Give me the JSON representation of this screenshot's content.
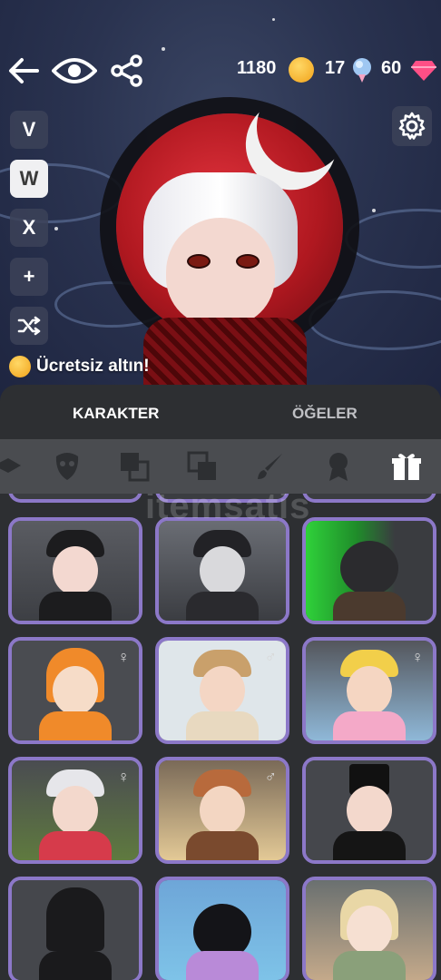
{
  "currency": {
    "gold": "1180",
    "gems_blue": "17",
    "gems_red": "60"
  },
  "side_buttons": [
    "V",
    "W",
    "X",
    "+"
  ],
  "free_gold_label": "Ücretsiz altın!",
  "tabs": [
    {
      "label": "KARAKTER",
      "active": true
    },
    {
      "label": "ÖĞELER",
      "active": false
    }
  ],
  "categories": [
    "clothing-icon",
    "mask-icon",
    "layers-icon",
    "layers-alt-icon",
    "brush-icon",
    "badge-icon",
    "gift-icon"
  ],
  "watermark": "itemsatis",
  "accent": "#8c78c8",
  "cards": [
    {
      "id": "priest-wings",
      "gender": ""
    },
    {
      "id": "masked-knight",
      "gender": ""
    },
    {
      "id": "werewolf",
      "gender": ""
    },
    {
      "id": "lion-costume",
      "gender": "♀"
    },
    {
      "id": "watermelon-boy",
      "gender": "♂"
    },
    {
      "id": "sick-kid",
      "gender": "♀"
    },
    {
      "id": "grandma-dogs",
      "gender": "♀"
    },
    {
      "id": "cafe-kid",
      "gender": "♂"
    },
    {
      "id": "mustache-gentleman",
      "gender": ""
    },
    {
      "id": "swat-soldier",
      "gender": ""
    },
    {
      "id": "black-cat",
      "gender": ""
    },
    {
      "id": "vintage-girl",
      "gender": ""
    }
  ]
}
